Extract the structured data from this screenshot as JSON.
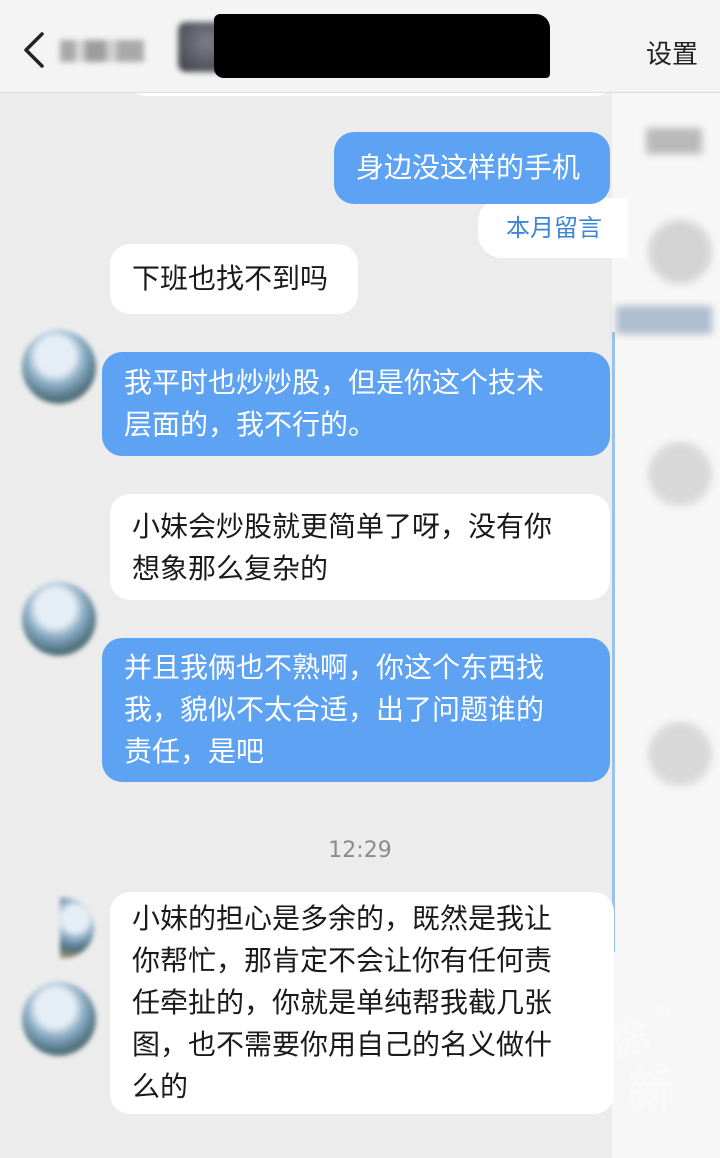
{
  "header": {
    "back_icon": "chevron-left-icon",
    "settings_label": "设置"
  },
  "reply_chip": {
    "label": "本月留言"
  },
  "messages": [
    {
      "side": "out",
      "lines": [
        "身边没这样的手机"
      ]
    },
    {
      "side": "in",
      "lines": [
        "下班也找不到吗"
      ]
    },
    {
      "side": "out",
      "lines": [
        "我平时也炒炒股，但是你这个技术",
        "层面的，我不行的。"
      ]
    },
    {
      "side": "in",
      "lines": [
        "小妹会炒股就更简单了呀，没有你",
        "想象那么复杂的"
      ]
    },
    {
      "side": "out",
      "lines": [
        "并且我俩也不熟啊，你这个东西找",
        "我，貌似不太合适，出了问题谁的",
        "责任，是吧"
      ]
    },
    {
      "side": "in",
      "lines": [
        "小妹的担心是多余的，既然是我让",
        "你帮忙，那肯定不会让你有任何责",
        "任牵扯的，你就是单纯帮我截几张",
        "图，也不需要你用自己的名义做什",
        "么的"
      ]
    }
  ],
  "timestamp": "12:29",
  "colors": {
    "outgoing_bubble": "#5ea3f3",
    "incoming_bubble": "#ffffff",
    "background": "#ececec"
  }
}
